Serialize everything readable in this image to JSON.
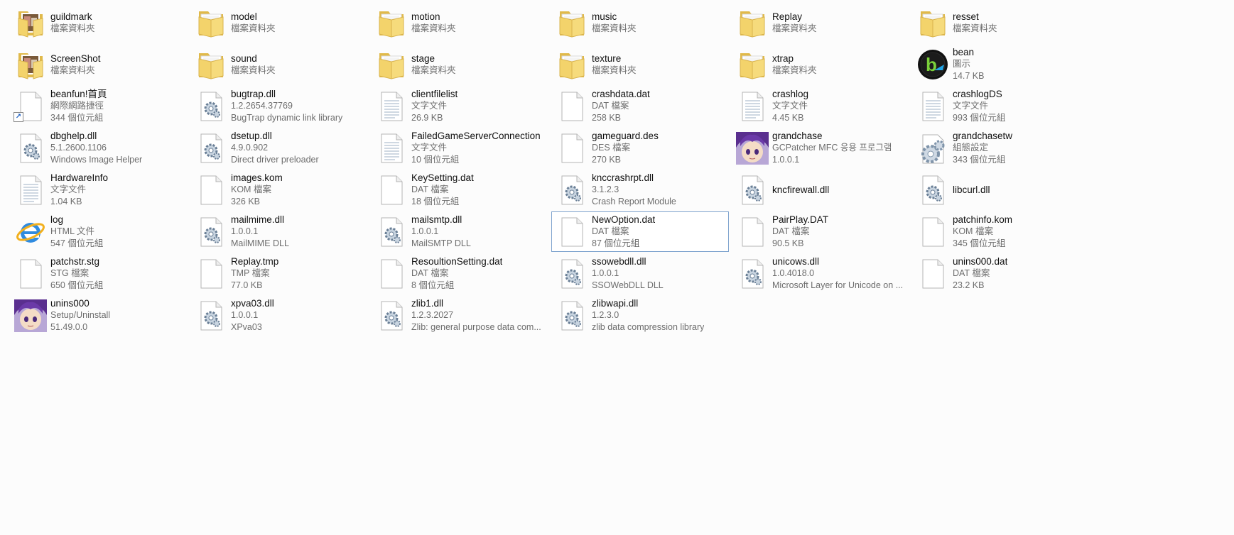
{
  "colors": {
    "background": "#fcfcfc",
    "selection_border": "#7da2ce",
    "folder": "#f3d36b",
    "text": "#111111",
    "subtext": "#6d6d6d"
  },
  "files": [
    {
      "name": "guildmark",
      "lines": [
        "檔案資料夾"
      ],
      "icon": "folder-photo-icon"
    },
    {
      "name": "model",
      "lines": [
        "檔案資料夾"
      ],
      "icon": "folder-icon"
    },
    {
      "name": "motion",
      "lines": [
        "檔案資料夾"
      ],
      "icon": "folder-icon"
    },
    {
      "name": "music",
      "lines": [
        "檔案資料夾"
      ],
      "icon": "folder-icon"
    },
    {
      "name": "Replay",
      "lines": [
        "檔案資料夾"
      ],
      "icon": "folder-icon"
    },
    {
      "name": "resset",
      "lines": [
        "檔案資料夾"
      ],
      "icon": "folder-icon"
    },
    {
      "name": "ScreenShot",
      "lines": [
        "檔案資料夾"
      ],
      "icon": "folder-photo-icon"
    },
    {
      "name": "sound",
      "lines": [
        "檔案資料夾"
      ],
      "icon": "folder-icon"
    },
    {
      "name": "stage",
      "lines": [
        "檔案資料夾"
      ],
      "icon": "folder-icon"
    },
    {
      "name": "texture",
      "lines": [
        "檔案資料夾"
      ],
      "icon": "folder-icon"
    },
    {
      "name": "xtrap",
      "lines": [
        "檔案資料夾"
      ],
      "icon": "folder-icon"
    },
    {
      "name": "bean",
      "lines": [
        "圖示",
        "14.7 KB"
      ],
      "icon": "beanfun-logo-icon"
    },
    {
      "name": "beanfun!首頁",
      "lines": [
        "網際網路捷徑",
        "344 個位元組"
      ],
      "icon": "internet-shortcut-icon",
      "shortcut": true
    },
    {
      "name": "bugtrap.dll",
      "lines": [
        "1.2.2654.37769",
        "BugTrap dynamic link library"
      ],
      "icon": "dll-gear-icon"
    },
    {
      "name": "clientfilelist",
      "lines": [
        "文字文件",
        "26.9 KB"
      ],
      "icon": "text-file-icon"
    },
    {
      "name": "crashdata.dat",
      "lines": [
        "DAT 檔案",
        "258 KB"
      ],
      "icon": "blank-file-icon"
    },
    {
      "name": "crashlog",
      "lines": [
        "文字文件",
        "4.45 KB"
      ],
      "icon": "text-file-icon"
    },
    {
      "name": "crashlogDS",
      "lines": [
        "文字文件",
        "993 個位元組"
      ],
      "icon": "text-file-icon"
    },
    {
      "name": "dbghelp.dll",
      "lines": [
        "5.1.2600.1106",
        "Windows Image Helper"
      ],
      "icon": "dll-gear-icon"
    },
    {
      "name": "dsetup.dll",
      "lines": [
        "4.9.0.902",
        "Direct driver preloader"
      ],
      "icon": "dll-gear-icon"
    },
    {
      "name": "FailedGameServerConnection",
      "lines": [
        "文字文件",
        "10 個位元組"
      ],
      "icon": "text-file-icon"
    },
    {
      "name": "gameguard.des",
      "lines": [
        "DES 檔案",
        "270 KB"
      ],
      "icon": "blank-file-icon"
    },
    {
      "name": "grandchase",
      "lines": [
        "GCPatcher MFC 응용 프로그램",
        "1.0.0.1"
      ],
      "icon": "character-avatar-icon"
    },
    {
      "name": "grandchasetw",
      "lines": [
        "組態設定",
        "343 個位元組"
      ],
      "icon": "config-gear-icon"
    },
    {
      "name": "HardwareInfo",
      "lines": [
        "文字文件",
        "1.04 KB"
      ],
      "icon": "text-file-icon"
    },
    {
      "name": "images.kom",
      "lines": [
        "KOM 檔案",
        "326 KB"
      ],
      "icon": "blank-file-icon"
    },
    {
      "name": "KeySetting.dat",
      "lines": [
        "DAT 檔案",
        "18 個位元組"
      ],
      "icon": "blank-file-icon"
    },
    {
      "name": "knccrashrpt.dll",
      "lines": [
        "3.1.2.3",
        "Crash Report Module"
      ],
      "icon": "dll-gear-icon"
    },
    {
      "name": "kncfirewall.dll",
      "lines": [],
      "icon": "dll-gear-icon"
    },
    {
      "name": "libcurl.dll",
      "lines": [],
      "icon": "dll-gear-icon"
    },
    {
      "name": "log",
      "lines": [
        "HTML 文件",
        "547 個位元組"
      ],
      "icon": "internet-explorer-icon"
    },
    {
      "name": "mailmime.dll",
      "lines": [
        "1.0.0.1",
        "MailMIME DLL"
      ],
      "icon": "dll-gear-icon"
    },
    {
      "name": "mailsmtp.dll",
      "lines": [
        "1.0.0.1",
        "MailSMTP DLL"
      ],
      "icon": "dll-gear-icon"
    },
    {
      "name": "NewOption.dat",
      "lines": [
        "DAT 檔案",
        "87 個位元組"
      ],
      "icon": "blank-file-icon",
      "selected": true
    },
    {
      "name": "PairPlay.DAT",
      "lines": [
        "DAT 檔案",
        "90.5 KB"
      ],
      "icon": "blank-file-icon"
    },
    {
      "name": "patchinfo.kom",
      "lines": [
        "KOM 檔案",
        "345 個位元組"
      ],
      "icon": "blank-file-icon"
    },
    {
      "name": "patchstr.stg",
      "lines": [
        "STG 檔案",
        "650 個位元組"
      ],
      "icon": "blank-file-icon"
    },
    {
      "name": "Replay.tmp",
      "lines": [
        "TMP 檔案",
        "77.0 KB"
      ],
      "icon": "blank-file-icon"
    },
    {
      "name": "ResoultionSetting.dat",
      "lines": [
        "DAT 檔案",
        "8 個位元組"
      ],
      "icon": "blank-file-icon"
    },
    {
      "name": "ssowebdll.dll",
      "lines": [
        "1.0.0.1",
        "SSOWebDLL DLL"
      ],
      "icon": "dll-gear-icon"
    },
    {
      "name": "unicows.dll",
      "lines": [
        "1.0.4018.0",
        "Microsoft Layer for Unicode on ..."
      ],
      "icon": "dll-gear-icon"
    },
    {
      "name": "unins000.dat",
      "lines": [
        "DAT 檔案",
        "23.2 KB"
      ],
      "icon": "blank-file-icon"
    },
    {
      "name": "unins000",
      "lines": [
        "Setup/Uninstall",
        "51.49.0.0"
      ],
      "icon": "character-avatar-icon"
    },
    {
      "name": "xpva03.dll",
      "lines": [
        "1.0.0.1",
        "XPva03"
      ],
      "icon": "dll-gear-icon"
    },
    {
      "name": "zlib1.dll",
      "lines": [
        "1.2.3.2027",
        "Zlib: general purpose data com..."
      ],
      "icon": "dll-gear-icon"
    },
    {
      "name": "zlibwapi.dll",
      "lines": [
        "1.2.3.0",
        "zlib data compression library"
      ],
      "icon": "dll-gear-icon"
    }
  ]
}
